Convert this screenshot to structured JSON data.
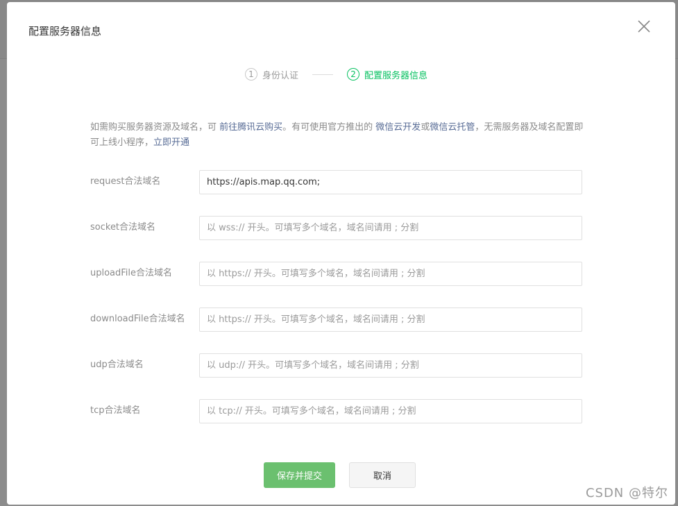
{
  "modal": {
    "title": "配置服务器信息",
    "close_icon": "close-icon"
  },
  "steps": [
    {
      "number": "1",
      "label": "身份认证",
      "active": false
    },
    {
      "number": "2",
      "label": "配置服务器信息",
      "active": true
    }
  ],
  "notice": {
    "text_1": "如需购买服务器资源及域名，可 ",
    "link_buy": "前往腾讯云购买",
    "text_2": "。有可使用官方推出的 ",
    "link_cloud_dev": "微信云开发",
    "text_3": "或",
    "link_cloud_host": "微信云托管",
    "text_4": "，无需服务器及域名配置即可上线小程序，",
    "link_open": "立即开通"
  },
  "form": {
    "request": {
      "label": "request合法域名",
      "value": "https://apis.map.qq.com;",
      "placeholder": ""
    },
    "socket": {
      "label": "socket合法域名",
      "value": "",
      "placeholder": "以 wss:// 开头。可填写多个域名，域名间请用 ; 分割"
    },
    "uploadFile": {
      "label": "uploadFile合法域名",
      "value": "",
      "placeholder": "以 https:// 开头。可填写多个域名，域名间请用 ; 分割"
    },
    "downloadFile": {
      "label": "downloadFile合法域名",
      "value": "",
      "placeholder": "以 https:// 开头。可填写多个域名，域名间请用 ; 分割"
    },
    "udp": {
      "label": "udp合法域名",
      "value": "",
      "placeholder": "以 udp:// 开头。可填写多个域名，域名间请用 ; 分割"
    },
    "tcp": {
      "label": "tcp合法域名",
      "value": "",
      "placeholder": "以 tcp:// 开头。可填写多个域名，域名间请用 ; 分割"
    }
  },
  "buttons": {
    "submit_label": "保存并提交",
    "cancel_label": "取消"
  },
  "watermark": "CSDN @特尔",
  "colors": {
    "primary_green": "#07c160",
    "button_green": "#6bc06f",
    "link_blue": "#576b95"
  }
}
